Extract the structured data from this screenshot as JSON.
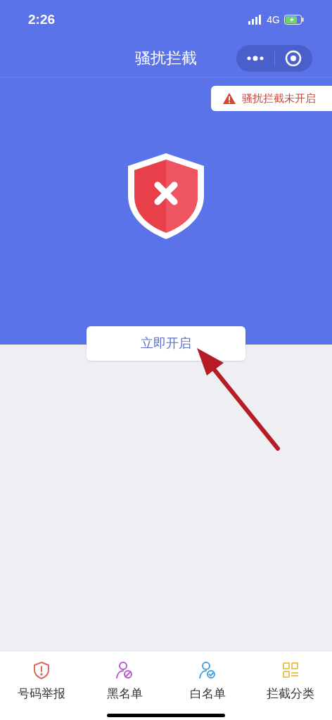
{
  "status_bar": {
    "time": "2:26",
    "network": "4G"
  },
  "nav": {
    "title": "骚扰拦截"
  },
  "warning": {
    "text": "骚扰拦截未开启"
  },
  "enable_button": {
    "label": "立即开启"
  },
  "tab_bar": [
    {
      "kind": "report",
      "label": "号码举报",
      "color": "#e0675f"
    },
    {
      "kind": "blacklist",
      "label": "黑名单",
      "color": "#b45bc8"
    },
    {
      "kind": "whitelist",
      "label": "白名单",
      "color": "#4d9fd8"
    },
    {
      "kind": "category",
      "label": "拦截分类",
      "color": "#e9c55a"
    }
  ]
}
